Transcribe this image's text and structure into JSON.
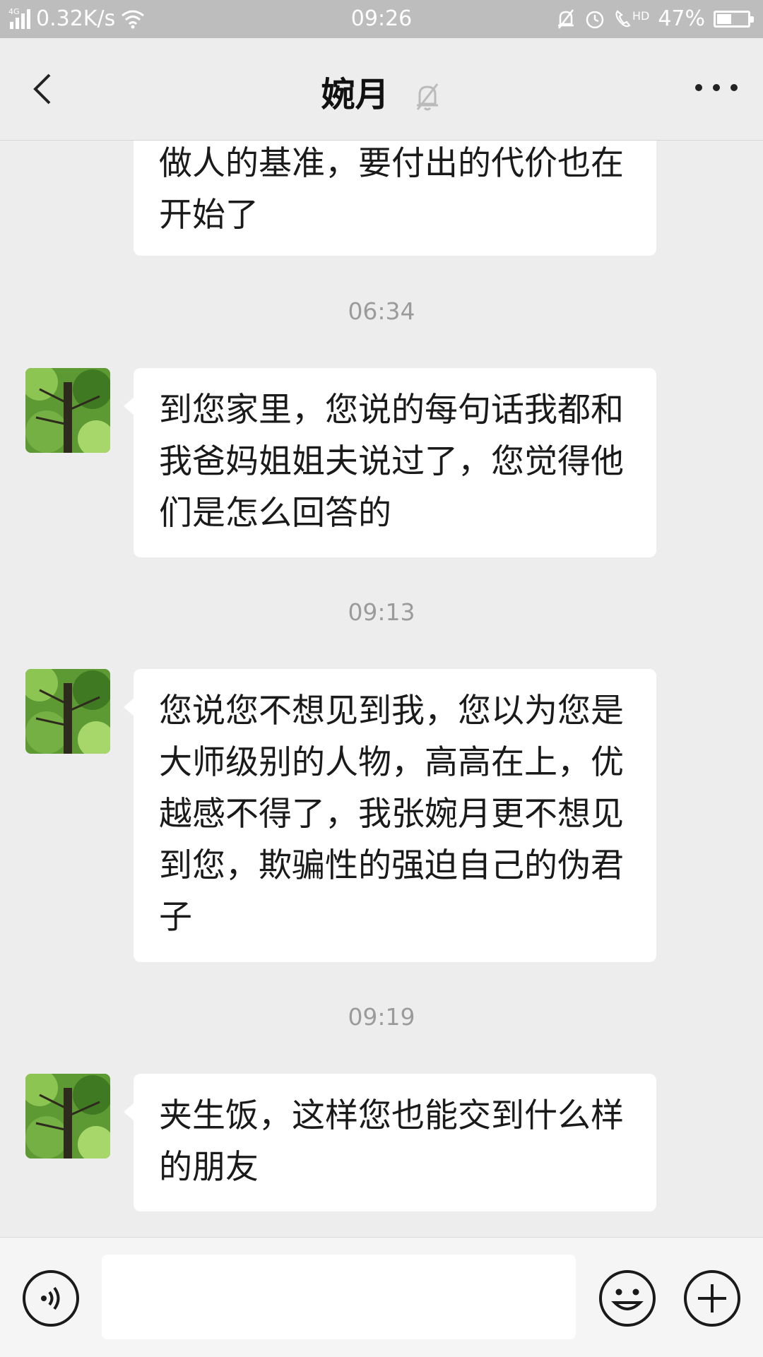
{
  "status_bar": {
    "network_type": "4G",
    "speed": "0.32K/s",
    "time": "09:26",
    "call_tag": "HD",
    "battery_percent": "47%",
    "battery_level": 0.47
  },
  "header": {
    "title": "婉月",
    "icons": {
      "back": "back-chevron-icon",
      "mute": "muted-bell-icon",
      "more": "more-dots-icon"
    }
  },
  "messages": [
    {
      "type": "received",
      "text": "做人的基准，要付出的代价也在开始了",
      "avatar": "tree-photo",
      "clipped_top": true
    },
    {
      "type": "time",
      "text": "06:34"
    },
    {
      "type": "received",
      "text": "到您家里，您说的每句话我都和我爸妈姐姐夫说过了，您觉得他们是怎么回答的",
      "avatar": "tree-photo"
    },
    {
      "type": "time",
      "text": "09:13"
    },
    {
      "type": "received",
      "text": "您说您不想见到我，您以为您是大师级别的人物，高高在上，优越感不得了，我张婉月更不想见到您，欺骗性的强迫自己的伪君子",
      "avatar": "tree-photo"
    },
    {
      "type": "time",
      "text": "09:19"
    },
    {
      "type": "received",
      "text": "夹生饭，这样您也能交到什么样的朋友",
      "avatar": "tree-photo"
    }
  ],
  "input_bar": {
    "value": "",
    "icons": {
      "voice": "voice-icon",
      "emoji": "emoji-icon",
      "plus": "plus-icon"
    }
  },
  "colors": {
    "background": "#ededed",
    "bubble": "#ffffff",
    "status_bar": "#bdbdbd",
    "time_label": "#9b9b9b"
  }
}
